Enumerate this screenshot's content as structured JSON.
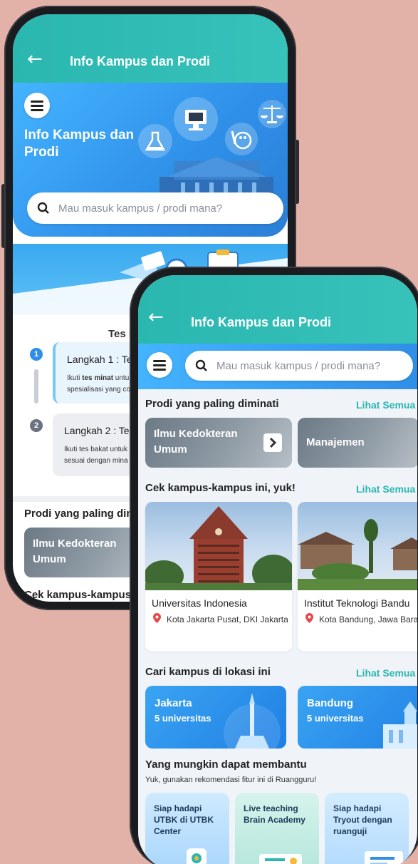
{
  "back_screen": {
    "appbar": {
      "back_icon": "arrow-left-icon",
      "title": "Info Kampus dan Prodi"
    },
    "hero": {
      "menu_icon": "menu-icon",
      "title_line1": "Info Kampus dan",
      "title_line2": "Prodi",
      "search_placeholder": "Mau masuk kampus / prodi mana?"
    },
    "tes_title": "Tes M",
    "steps": [
      {
        "number": "1",
        "title": "Langkah 1 : Tes M",
        "desc_pre": "Ikuti ",
        "desc_bold": "tes minat",
        "desc_post": " untu",
        "desc_line2": "spesialisasi yang co"
      },
      {
        "number": "2",
        "title": "Langkah 2 : Tes B",
        "desc_line1": "Ikuti tes bakat untuk",
        "desc_line2": "sesuai dengan mina"
      }
    ],
    "section_prodi": "Prodi yang paling dimi",
    "prodi_card_line1": "Ilmu Kedokteran",
    "prodi_card_line2": "Umum",
    "section_kampus": "Cek kampus-kampus in"
  },
  "front_screen": {
    "appbar": {
      "back_icon": "arrow-left-icon",
      "title": "Info Kampus dan Prodi"
    },
    "search_placeholder": "Mau masuk kampus / prodi mana?",
    "section_prodi": {
      "title": "Prodi yang paling diminati",
      "more": "Lihat Semua"
    },
    "prodi_cards": [
      {
        "line1": "Ilmu Kedokteran",
        "line2": "Umum"
      },
      {
        "line1": "Manajemen",
        "line2": ""
      }
    ],
    "section_kampus": {
      "title": "Cek kampus-kampus ini, yuk!",
      "more": "Lihat Semua"
    },
    "campuses": [
      {
        "name": "Universitas Indonesia",
        "location": "Kota Jakarta Pusat, DKI Jakarta"
      },
      {
        "name": "Institut Teknologi Bandu",
        "location": "Kota Bandung, Jawa Bara"
      }
    ],
    "section_lokasi": {
      "title": "Cari kampus di lokasi ini",
      "more": "Lihat Semua"
    },
    "cities": [
      {
        "name": "Jakarta",
        "count": "5 universitas"
      },
      {
        "name": "Bandung",
        "count": "5 universitas"
      }
    ],
    "section_help": {
      "title": "Yang mungkin dapat membantu",
      "subtitle": "Yuk, gunakan rekomendasi fitur ini di Ruangguru!"
    },
    "help_cards": [
      {
        "line1": "Siap hadapi",
        "line2": "UTBK di UTBK",
        "line3": "Center"
      },
      {
        "line1": "Live teaching",
        "line2": "Brain Academy",
        "line3": ""
      },
      {
        "line1": "Siap hadapi",
        "line2": "Tryout dengan",
        "line3": "ruanguji"
      }
    ]
  },
  "colors": {
    "background": "#e2b2a8",
    "appbar_teal": "#2ab7b0",
    "hero_blue": "#2f8fe8",
    "link_teal": "#2ab7b0",
    "pin_red": "#e5484d"
  }
}
